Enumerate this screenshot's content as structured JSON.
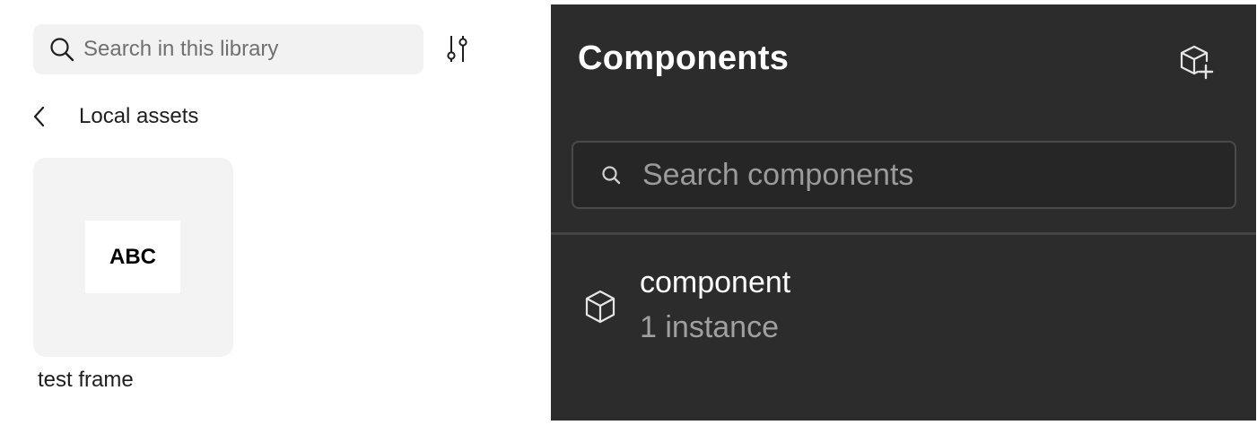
{
  "library_panel": {
    "search": {
      "placeholder": "Search in this library",
      "value": ""
    },
    "filter_icon": "sliders-icon",
    "back_nav": {
      "label": "Local assets",
      "icon": "chevron-left-icon"
    },
    "assets": [
      {
        "thumbnail_text": "ABC",
        "name": "test frame"
      }
    ]
  },
  "components_panel": {
    "title": "Components",
    "create_icon": "create-component-icon",
    "search": {
      "placeholder": "Search components",
      "value": ""
    },
    "items": [
      {
        "icon": "component-cube-icon",
        "name": "component",
        "instances": "1 instance"
      }
    ]
  },
  "colors": {
    "light_bg": "#ffffff",
    "light_field_bg": "#f2f2f2",
    "dark_bg": "#2c2c2c",
    "dark_field_border": "#4a4a4a",
    "dark_text": "#ffffff",
    "dark_muted_text": "#a0a0a0"
  }
}
